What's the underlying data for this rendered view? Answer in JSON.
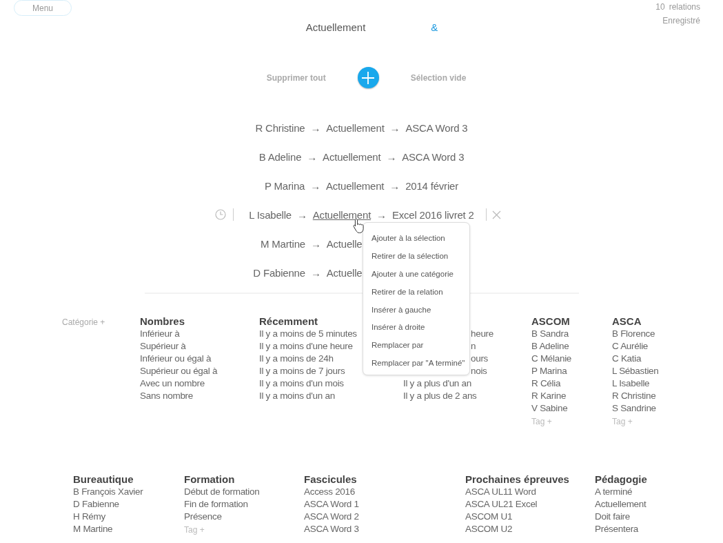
{
  "menu_button": {
    "label": "Menu"
  },
  "status": {
    "count": "10",
    "count_label": "relations",
    "save_state": "Enregistré"
  },
  "title": {
    "text": "Actuellement",
    "connector": "&"
  },
  "actions": {
    "clear_all": "Supprimer tout",
    "selection": "Sélection vide"
  },
  "relations": [
    {
      "active": false,
      "kind": "full",
      "items": [
        {
          "kind": "term",
          "text": "R Christine",
          "hovered": false
        },
        {
          "kind": "arrow",
          "text": "→"
        },
        {
          "kind": "term",
          "text": "Actuellement",
          "hovered": false
        },
        {
          "kind": "arrow",
          "text": "→"
        },
        {
          "kind": "term",
          "text": "ASCA Word 3",
          "hovered": false
        }
      ]
    },
    {
      "active": false,
      "kind": "full",
      "items": [
        {
          "kind": "term",
          "text": "B Adeline",
          "hovered": false
        },
        {
          "kind": "arrow",
          "text": "→"
        },
        {
          "kind": "term",
          "text": "Actuellement",
          "hovered": false
        },
        {
          "kind": "arrow",
          "text": "→"
        },
        {
          "kind": "term",
          "text": "ASCA Word 3",
          "hovered": false
        }
      ]
    },
    {
      "active": false,
      "kind": "full",
      "items": [
        {
          "kind": "term",
          "text": "P Marina",
          "hovered": false
        },
        {
          "kind": "arrow",
          "text": "→"
        },
        {
          "kind": "term",
          "text": "Actuellement",
          "hovered": false
        },
        {
          "kind": "arrow",
          "text": "→"
        },
        {
          "kind": "term",
          "text": "2014 février",
          "hovered": false
        }
      ]
    },
    {
      "active": true,
      "kind": "full",
      "items": [
        {
          "kind": "term",
          "text": "L Isabelle",
          "hovered": false
        },
        {
          "kind": "arrow",
          "text": "→"
        },
        {
          "kind": "term",
          "text": "Actuellement",
          "hovered": true
        },
        {
          "kind": "arrow",
          "text": "→"
        },
        {
          "kind": "term",
          "text": "Excel 2016 livret 2",
          "hovered": false
        }
      ]
    },
    {
      "active": false,
      "kind": "covered",
      "items": [
        {
          "kind": "term",
          "text": "M Martine",
          "hovered": false
        },
        {
          "kind": "arrow",
          "text": "→"
        },
        {
          "kind": "term",
          "text": "Actuelle",
          "hovered": false
        }
      ]
    },
    {
      "active": false,
      "kind": "covered",
      "items": [
        {
          "kind": "term",
          "text": "D Fabienne",
          "hovered": false
        },
        {
          "kind": "arrow",
          "text": "→"
        },
        {
          "kind": "term",
          "text": "Actuelle",
          "hovered": false
        }
      ]
    }
  ],
  "context_menu": {
    "items": [
      "Ajouter à la sélection",
      "Retirer de la sélection",
      "Ajouter à une catégorie",
      "Retirer de la relation",
      "Insérer à gauche",
      "Insérer à droite",
      "Remplacer par",
      "Remplacer par \"A terminé\""
    ]
  },
  "categories_top": {
    "add_label": "Catégorie +",
    "columns": [
      {
        "header": "Nombres",
        "items": [
          {
            "kind": "value",
            "text": "Inférieur à"
          },
          {
            "kind": "value",
            "text": "Supérieur à"
          },
          {
            "kind": "value",
            "text": "Inférieur ou égal à"
          },
          {
            "kind": "value",
            "text": "Supérieur ou égal à"
          },
          {
            "kind": "value",
            "text": "Avec un nombre"
          },
          {
            "kind": "value",
            "text": "Sans nombre"
          }
        ]
      },
      {
        "header": "Récemment",
        "items": [
          {
            "kind": "value",
            "text": "Il y a moins de 5 minutes"
          },
          {
            "kind": "value",
            "text": "Il y a moins d'une heure"
          },
          {
            "kind": "value",
            "text": "Il y a moins de 24h"
          },
          {
            "kind": "value",
            "text": "Il y a moins de 7 jours"
          },
          {
            "kind": "value",
            "text": "Il y a moins d'un mois"
          },
          {
            "kind": "value",
            "text": "Il y a moins d'un an"
          }
        ]
      },
      {
        "items": [
          {
            "kind": "covered",
            "text": "heure"
          },
          {
            "kind": "covered",
            "text": "n"
          },
          {
            "kind": "covered",
            "text": "ours"
          },
          {
            "kind": "covered",
            "text": "nois"
          },
          {
            "kind": "value",
            "text": "Il y a plus d'un an"
          },
          {
            "kind": "value",
            "text": "Il y a plus de 2 ans"
          }
        ]
      },
      {
        "header": "ASCOM",
        "items": [
          {
            "kind": "value",
            "text": "B Sandra"
          },
          {
            "kind": "value",
            "text": "B Adeline"
          },
          {
            "kind": "value",
            "text": "C Mélanie"
          },
          {
            "kind": "value",
            "text": "P Marina"
          },
          {
            "kind": "value",
            "text": "R Célia"
          },
          {
            "kind": "value",
            "text": "R Karine"
          },
          {
            "kind": "value",
            "text": "V Sabine"
          },
          {
            "kind": "tag",
            "text": "Tag +"
          }
        ]
      },
      {
        "header": "ASCA",
        "items": [
          {
            "kind": "value",
            "text": "B Florence"
          },
          {
            "kind": "value",
            "text": "C Aurélie"
          },
          {
            "kind": "value",
            "text": "C Katia"
          },
          {
            "kind": "value",
            "text": "L Sébastien"
          },
          {
            "kind": "value",
            "text": "L Isabelle"
          },
          {
            "kind": "value",
            "text": "R Christine"
          },
          {
            "kind": "value",
            "text": "S Sandrine"
          },
          {
            "kind": "tag",
            "text": "Tag +"
          }
        ]
      }
    ]
  },
  "categories_bottom": {
    "columns": [
      {
        "header": "Bureautique",
        "items": [
          {
            "kind": "value",
            "text": "B François Xavier"
          },
          {
            "kind": "value",
            "text": "D Fabienne"
          },
          {
            "kind": "value",
            "text": "H Rémy"
          },
          {
            "kind": "value",
            "text": "M Martine"
          }
        ]
      },
      {
        "header": "Formation",
        "items": [
          {
            "kind": "value",
            "text": "Début de formation"
          },
          {
            "kind": "value",
            "text": "Fin de formation"
          },
          {
            "kind": "value",
            "text": "Présence"
          },
          {
            "kind": "tag",
            "text": "Tag +"
          }
        ]
      },
      {
        "header": "Fascicules",
        "items": [
          {
            "kind": "value",
            "text": "Access 2016"
          },
          {
            "kind": "value",
            "text": "ASCA Word 1"
          },
          {
            "kind": "value",
            "text": "ASCA Word 2"
          },
          {
            "kind": "value",
            "text": "ASCA Word 3"
          }
        ]
      },
      {
        "header": "Prochaines épreuves",
        "items": [
          {
            "kind": "value",
            "text": "ASCA UL11 Word"
          },
          {
            "kind": "value",
            "text": "ASCA UL21 Excel"
          },
          {
            "kind": "value",
            "text": "ASCOM U1"
          },
          {
            "kind": "value",
            "text": "ASCOM U2"
          }
        ]
      },
      {
        "header": "Pédagogie",
        "items": [
          {
            "kind": "value",
            "text": "A terminé"
          },
          {
            "kind": "value",
            "text": "Actuellement"
          },
          {
            "kind": "value",
            "text": "Doit faire"
          },
          {
            "kind": "value",
            "text": "Présentera"
          }
        ]
      }
    ]
  }
}
